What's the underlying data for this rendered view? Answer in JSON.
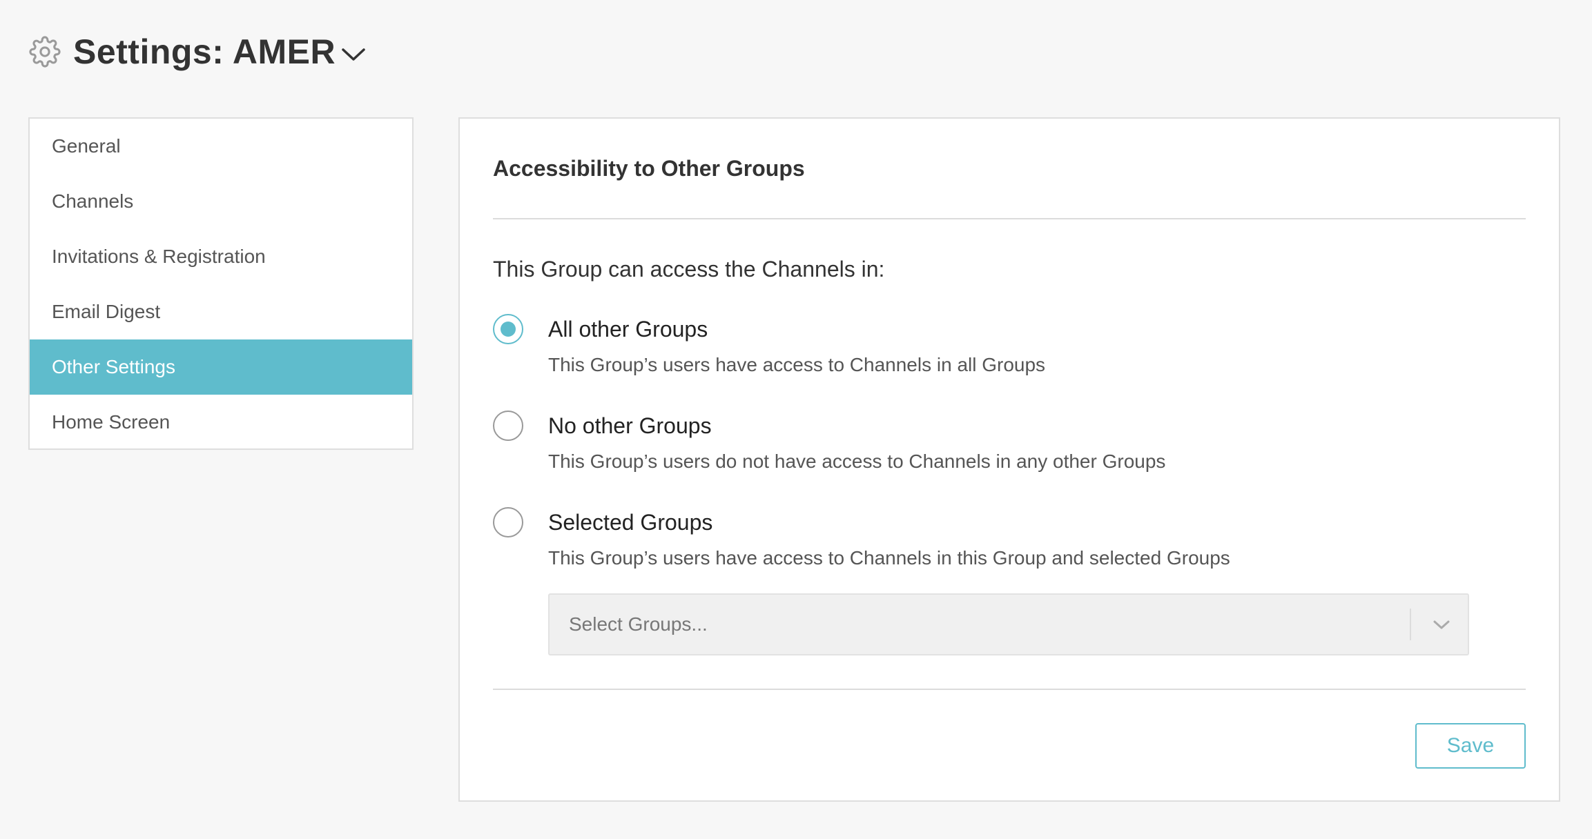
{
  "header": {
    "title": "Settings: AMER",
    "icon": "gear-icon",
    "dropdown_icon": "chevron-down-icon"
  },
  "sidebar": {
    "items": [
      {
        "label": "General",
        "active": false
      },
      {
        "label": "Channels",
        "active": false
      },
      {
        "label": "Invitations & Registration",
        "active": false
      },
      {
        "label": "Email Digest",
        "active": false
      },
      {
        "label": "Other Settings",
        "active": true
      },
      {
        "label": "Home Screen",
        "active": false
      }
    ]
  },
  "main": {
    "section_title": "Accessibility to Other Groups",
    "lead_text": "This Group can access the Channels in:",
    "options": [
      {
        "label": "All other Groups",
        "description": "This Group’s users have access to Channels in all Groups",
        "selected": true
      },
      {
        "label": "No other Groups",
        "description": "This Group’s users do not have access to Channels in any other Groups",
        "selected": false
      },
      {
        "label": "Selected Groups",
        "description": "This Group’s users have access to Channels in this Group and selected Groups",
        "selected": false
      }
    ],
    "select": {
      "placeholder": "Select Groups..."
    },
    "save_label": "Save"
  },
  "colors": {
    "accent": "#5fbccc",
    "background": "#f7f7f7",
    "panel": "#ffffff",
    "border": "#dedede"
  }
}
